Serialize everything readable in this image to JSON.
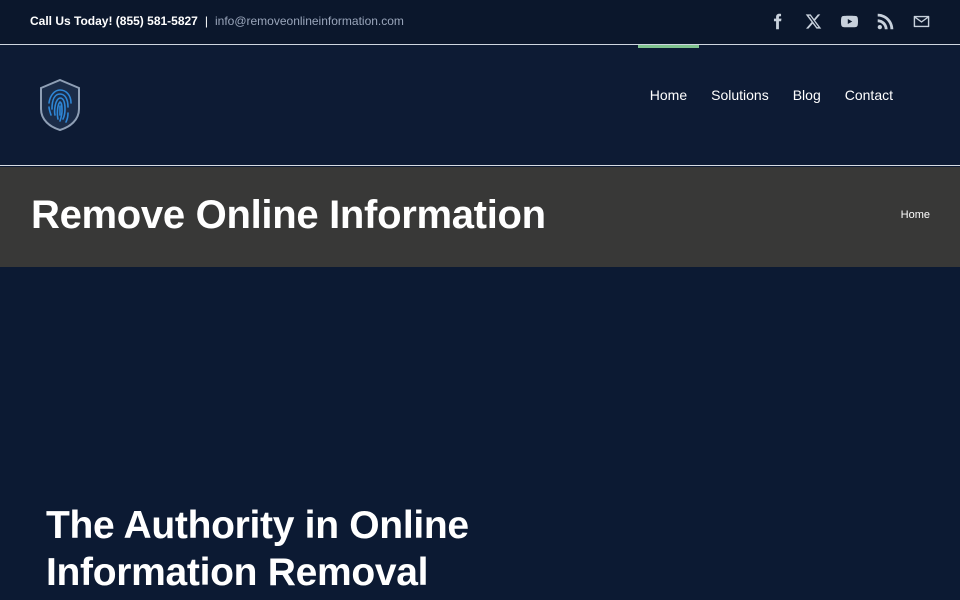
{
  "topbar": {
    "phone": "Call Us Today! (855) 581-5827",
    "separator": "|",
    "email": "info@removeonlineinformation.com",
    "social": [
      {
        "icon": "facebook-icon"
      },
      {
        "icon": "x-twitter-icon"
      },
      {
        "icon": "youtube-icon"
      },
      {
        "icon": "rss-icon"
      },
      {
        "icon": "email-icon"
      }
    ]
  },
  "header": {
    "logo_icon": "fingerprint-shield-icon",
    "nav": [
      {
        "label": "Home",
        "active": true
      },
      {
        "label": "Solutions",
        "active": false
      },
      {
        "label": "Blog",
        "active": false
      },
      {
        "label": "Contact",
        "active": false
      }
    ],
    "accent_color": "#7fc28e"
  },
  "titlebar": {
    "title": "Remove Online Information",
    "breadcrumb": "Home"
  },
  "hero": {
    "heading_line1": "The Authority in Online",
    "heading_line2": "Information Removal"
  }
}
